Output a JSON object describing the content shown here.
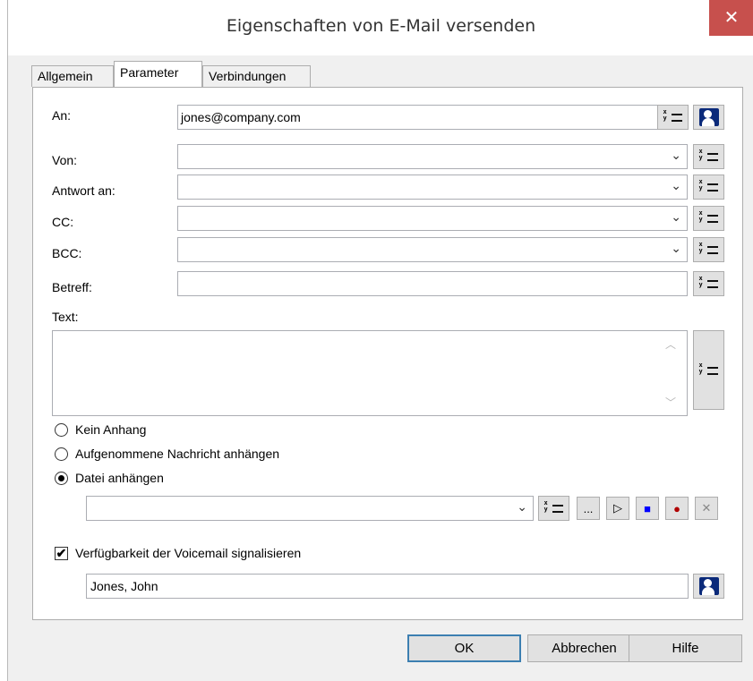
{
  "window": {
    "title": "Eigenschaften von E-Mail versenden",
    "close_glyph": "✕"
  },
  "tabs": [
    {
      "label": "Allgemein"
    },
    {
      "label": "Parameter"
    },
    {
      "label": "Verbindungen"
    }
  ],
  "fields": {
    "an": {
      "label": "An:",
      "value": "jones@company.com"
    },
    "von": {
      "label": "Von:",
      "value": ""
    },
    "antwort": {
      "label": "Antwort an:",
      "value": ""
    },
    "cc": {
      "label": "CC:",
      "value": ""
    },
    "bcc": {
      "label": "BCC:",
      "value": ""
    },
    "betreff": {
      "label": "Betreff:",
      "value": ""
    },
    "text": {
      "label": "Text:",
      "value": ""
    }
  },
  "attachment": {
    "options": [
      {
        "label": "Kein Anhang",
        "selected": false
      },
      {
        "label": "Aufgenommene Nachricht anhängen",
        "selected": false
      },
      {
        "label": "Datei anhängen",
        "selected": true
      }
    ],
    "file_value": "",
    "browse_label": "...",
    "play_glyph": "▷",
    "stop_glyph": "■",
    "record_glyph": "●",
    "delete_glyph": "✕"
  },
  "voicemail": {
    "label": "Verfügbarkeit der Voicemail signalisieren",
    "checked": true,
    "check_glyph": "✔",
    "recipient": "Jones, John"
  },
  "icons": {
    "arrow": "⌄",
    "scroll_up": "︿",
    "scroll_down": "﹀",
    "variable": "variable-insert-icon",
    "address_book": "address-book-icon"
  },
  "buttons": {
    "ok": "OK",
    "cancel": "Abbrechen",
    "help": "Hilfe"
  },
  "colors": {
    "close": "#c7504d",
    "stop": "#0000ff",
    "record": "#b00000"
  }
}
